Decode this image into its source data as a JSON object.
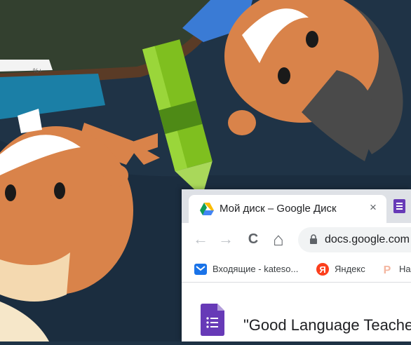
{
  "scene": {
    "notebook_text": "%+",
    "colors": {
      "background": "#1f3346",
      "skin": "#d9834a",
      "hair": "#4a4a4a",
      "pencil": "#7fbf1f",
      "table": "#3c4a36"
    }
  },
  "browser": {
    "tabs": [
      {
        "title": "Мой диск – Google Диск",
        "icon": "google-drive-icon"
      },
      {
        "title": "",
        "icon": "google-forms-icon"
      }
    ],
    "tab_close": "×",
    "toolbar": {
      "back": "←",
      "forward": "→",
      "reload": "C",
      "home": "⌂"
    },
    "url": "docs.google.com",
    "bookmarks": [
      {
        "label": "Входящие - kateso...",
        "icon": "mail-icon"
      },
      {
        "label": "Яндекс",
        "icon": "yandex-icon"
      },
      {
        "label": "На",
        "icon": "pinterest-icon"
      }
    ],
    "document_title": "\"Good Language Teacher"
  }
}
